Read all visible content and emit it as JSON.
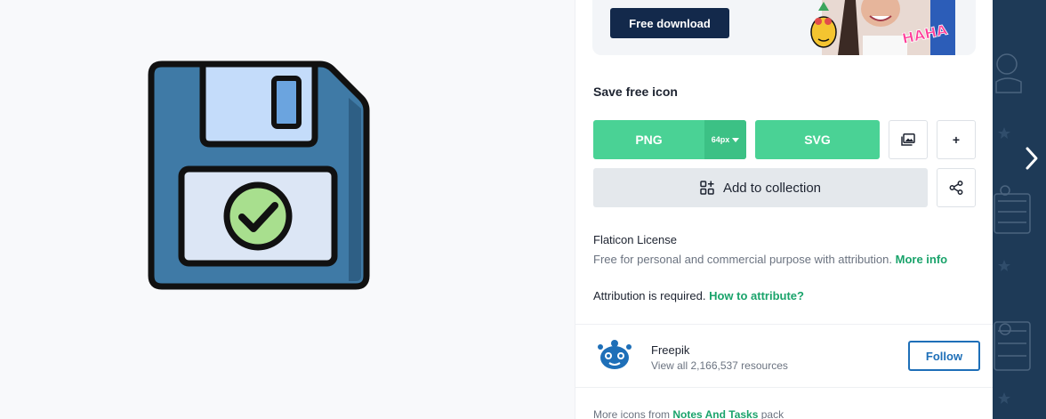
{
  "preview": {
    "icon": "floppy-disk-check-icon"
  },
  "banner": {
    "download_label": "Free download",
    "promo_text": "HAHA"
  },
  "save": {
    "title": "Save free icon",
    "png_label": "PNG",
    "png_size": "64px",
    "svg_label": "SVG",
    "add_collection_label": "Add to collection",
    "more_label": "+"
  },
  "license": {
    "title": "Flaticon License",
    "description": "Free for personal and commercial purpose with attribution.",
    "more_info": "More info",
    "attribution": "Attribution is required.",
    "how_to": "How to attribute?"
  },
  "author": {
    "name": "Freepik",
    "resources": "View all 2,166,537 resources",
    "follow_label": "Follow"
  },
  "more": {
    "prefix": "More icons from",
    "pack": "Notes And Tasks",
    "suffix": "pack"
  },
  "colors": {
    "accent_green": "#4ad295",
    "navy": "#13294b",
    "follow_blue": "#1e6fb8",
    "link_green": "#1aa36b",
    "gutter": "#1e3a57"
  }
}
